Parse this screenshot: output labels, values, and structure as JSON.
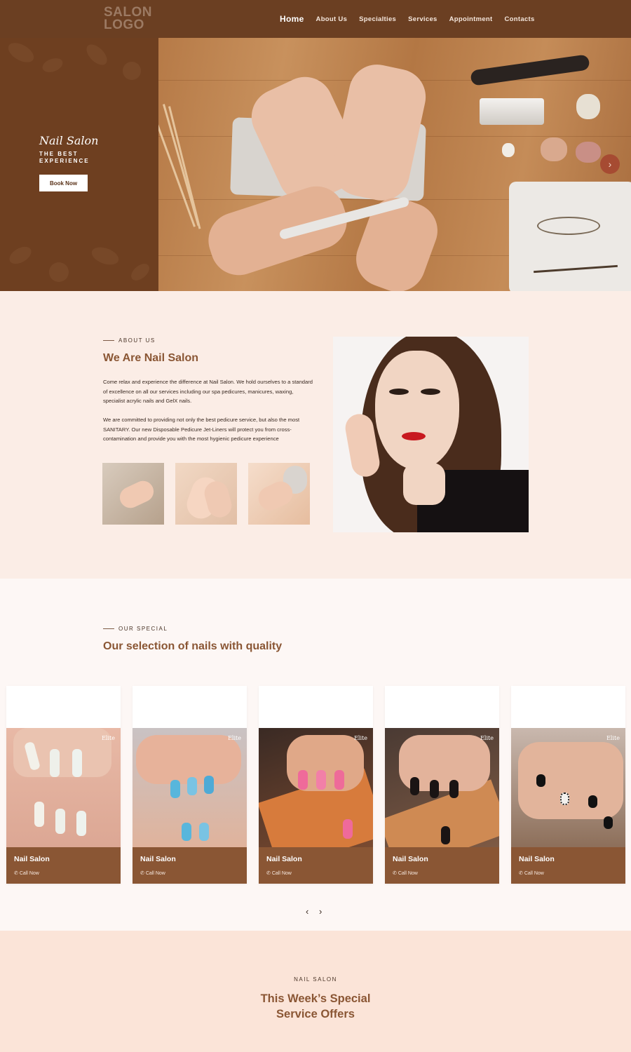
{
  "header": {
    "logo": "SALON LOGO",
    "nav": [
      "Home",
      "About Us",
      "Specialties",
      "Services",
      "Appointment",
      "Contacts"
    ]
  },
  "hero": {
    "title": "Nail Salon",
    "subtitle": "THE BEST EXPERIENCE",
    "button": "Book Now",
    "next_icon": "chevron-right-icon"
  },
  "about": {
    "eyebrow": "ABOUT US",
    "heading": "We Are Nail Salon",
    "paragraph1": "Come relax and experience the difference at Nail Salon. We hold ourselves to a standard of excellence on all our services including our spa pedicures, manicures, waxing, specialist acrylic nails and GelX nails.",
    "paragraph2": "We are committed to providing not only the best pedicure service, but also the most SANITARY. Our new Disposable Pedicure Jet-Liners will protect you from cross-contamination and provide you with the most hygienic pedicure experience"
  },
  "special": {
    "eyebrow": "OUR SPECIAL",
    "heading": "Our selection of nails with quality",
    "brand": "Elite",
    "cards": [
      {
        "title": "Nail Salon",
        "cta": "Call Now"
      },
      {
        "title": "Nail Salon",
        "cta": "Call Now"
      },
      {
        "title": "Nail Salon",
        "cta": "Call Now"
      },
      {
        "title": "Nail Salon",
        "cta": "Call Now"
      },
      {
        "title": "Nail Salon",
        "cta": "Call Now"
      }
    ],
    "prev": "‹",
    "next": "›"
  },
  "offers": {
    "eyebrow": "NAIL SALON",
    "heading_line1": "This Week’s Special",
    "heading_line2": "Service Offers"
  },
  "colors": {
    "brand_brown": "#6b3f22",
    "accent_brown": "#8a5634",
    "page_bg": "#fbede6"
  }
}
